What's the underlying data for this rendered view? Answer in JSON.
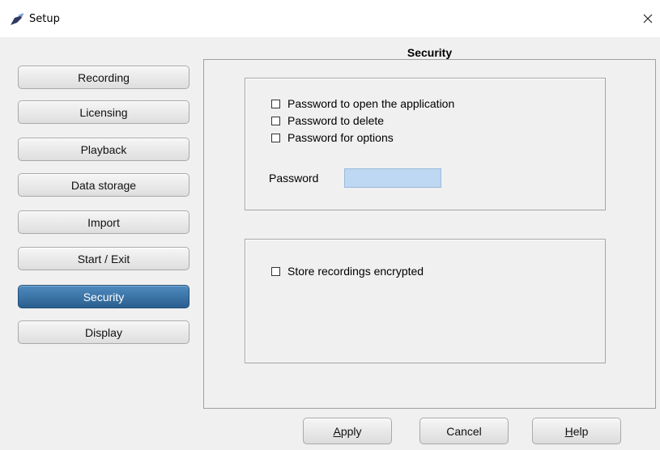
{
  "window": {
    "title": "Setup"
  },
  "sidebar": {
    "items": [
      {
        "label": "Recording"
      },
      {
        "label": "Licensing"
      },
      {
        "label": "Playback"
      },
      {
        "label": "Data storage"
      },
      {
        "label": "Import"
      },
      {
        "label": "Start / Exit"
      },
      {
        "label": "Security",
        "active": true
      },
      {
        "label": "Display"
      }
    ]
  },
  "main": {
    "section_title": "Security",
    "password_group": {
      "options": [
        {
          "label": "Password to open the application",
          "checked": false
        },
        {
          "label": "Password to delete",
          "checked": false
        },
        {
          "label": "Password for options",
          "checked": false
        }
      ],
      "password_label": "Password",
      "password_value": ""
    },
    "encryption_group": {
      "option": {
        "label": "Store recordings encrypted",
        "checked": false
      }
    }
  },
  "footer": {
    "apply": {
      "mnemonic": "A",
      "rest": "pply"
    },
    "cancel": {
      "label": "Cancel"
    },
    "help": {
      "mnemonic": "H",
      "rest": "elp"
    }
  },
  "colors": {
    "active_button": "#2f6797",
    "password_field": "#bed7f2"
  }
}
